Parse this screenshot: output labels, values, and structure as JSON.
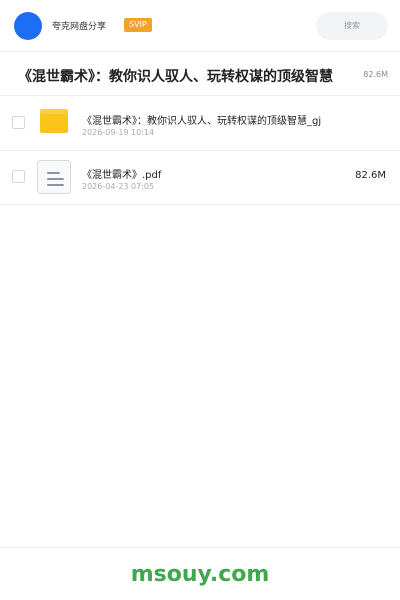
{
  "header": {
    "user_name": "夸克网盘分享",
    "badge": "SVIP",
    "search_placeholder": "搜索"
  },
  "folder": {
    "title": "《混世霸术》：教你识人驭人、玩转权谋的顶级智慧",
    "size": "82.6M"
  },
  "files": [
    {
      "name": "《混世霸术》：教你识人驭人、玩转权谋的顶级智慧_gj",
      "date": "2026-09-19 10:14",
      "size": "",
      "icon": "folder-icon"
    },
    {
      "name": "《混世霸术》.pdf",
      "date": "2026-04-23 07:05",
      "size": "82.6M",
      "icon": "document-icon"
    }
  ],
  "watermark": "msouy.com",
  "colors": {
    "avatar": "#1e6ef5",
    "badge": "#f3a32a",
    "folder": "#fbc41b",
    "watermark": "#3fa84a"
  }
}
